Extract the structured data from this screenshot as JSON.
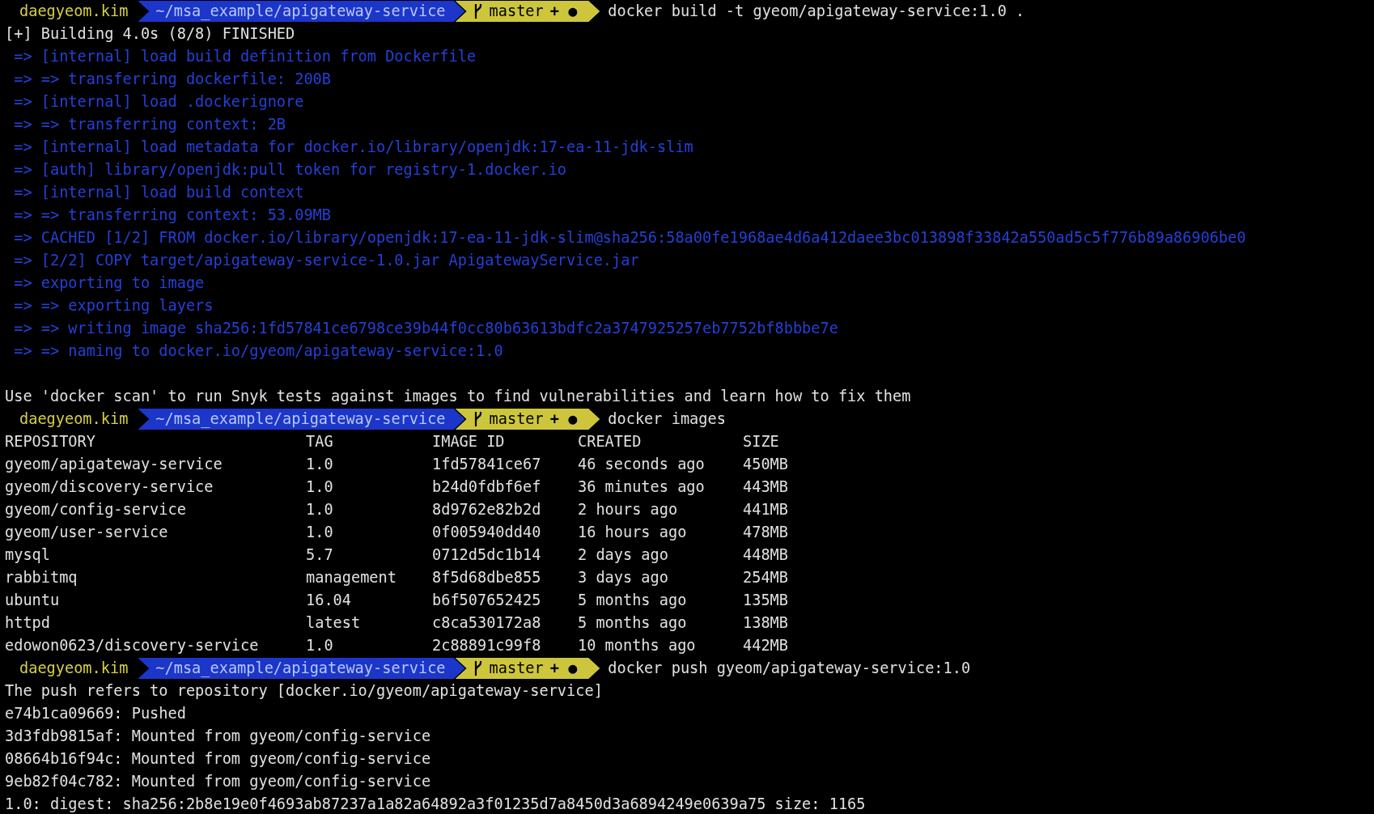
{
  "blocks": [
    {
      "kind": "prompt",
      "user": "daegyeom.kim",
      "path": "~/msa_example/apigateway-service",
      "branch": "master",
      "status": "+ ●",
      "command": "docker build -t gyeom/apigateway-service:1.0 ."
    },
    {
      "kind": "output",
      "text": "[+] Building 4.0s (8/8) FINISHED"
    },
    {
      "kind": "build",
      "text": " => [internal] load build definition from Dockerfile"
    },
    {
      "kind": "build",
      "text": " => => transferring dockerfile: 200B"
    },
    {
      "kind": "build",
      "text": " => [internal] load .dockerignore"
    },
    {
      "kind": "build",
      "text": " => => transferring context: 2B"
    },
    {
      "kind": "build",
      "text": " => [internal] load metadata for docker.io/library/openjdk:17-ea-11-jdk-slim"
    },
    {
      "kind": "build",
      "text": " => [auth] library/openjdk:pull token for registry-1.docker.io"
    },
    {
      "kind": "build",
      "text": " => [internal] load build context"
    },
    {
      "kind": "build",
      "text": " => => transferring context: 53.09MB"
    },
    {
      "kind": "build",
      "text": " => CACHED [1/2] FROM docker.io/library/openjdk:17-ea-11-jdk-slim@sha256:58a00fe1968ae4d6a412daee3bc013898f33842a550ad5c5f776b89a86906be0"
    },
    {
      "kind": "build",
      "text": " => [2/2] COPY target/apigateway-service-1.0.jar ApigatewayService.jar"
    },
    {
      "kind": "build",
      "text": " => exporting to image"
    },
    {
      "kind": "build",
      "text": " => => exporting layers"
    },
    {
      "kind": "build",
      "text": " => => writing image sha256:1fd57841ce6798ce39b44f0cc80b63613bdfc2a3747925257eb7752bf8bbbe7e"
    },
    {
      "kind": "build",
      "text": " => => naming to docker.io/gyeom/apigateway-service:1.0"
    },
    {
      "kind": "blank"
    },
    {
      "kind": "output",
      "text": "Use 'docker scan' to run Snyk tests against images to find vulnerabilities and learn how to fix them"
    },
    {
      "kind": "prompt",
      "user": "daegyeom.kim",
      "path": "~/msa_example/apigateway-service",
      "branch": "master",
      "status": "+ ●",
      "command": "docker images"
    },
    {
      "kind": "table",
      "columns": [
        "REPOSITORY",
        "TAG",
        "IMAGE ID",
        "CREATED",
        "SIZE"
      ],
      "rows": [
        [
          "gyeom/apigateway-service",
          "1.0",
          "1fd57841ce67",
          "46 seconds ago",
          "450MB"
        ],
        [
          "gyeom/discovery-service",
          "1.0",
          "b24d0fdbf6ef",
          "36 minutes ago",
          "443MB"
        ],
        [
          "gyeom/config-service",
          "1.0",
          "8d9762e82b2d",
          "2 hours ago",
          "441MB"
        ],
        [
          "gyeom/user-service",
          "1.0",
          "0f005940dd40",
          "16 hours ago",
          "478MB"
        ],
        [
          "mysql",
          "5.7",
          "0712d5dc1b14",
          "2 days ago",
          "448MB"
        ],
        [
          "rabbitmq",
          "management",
          "8f5d68dbe855",
          "3 days ago",
          "254MB"
        ],
        [
          "ubuntu",
          "16.04",
          "b6f507652425",
          "5 months ago",
          "135MB"
        ],
        [
          "httpd",
          "latest",
          "c8ca530172a8",
          "5 months ago",
          "138MB"
        ],
        [
          "edowon0623/discovery-service",
          "1.0",
          "2c88891c99f8",
          "10 months ago",
          "442MB"
        ]
      ]
    },
    {
      "kind": "prompt",
      "user": "daegyeom.kim",
      "path": "~/msa_example/apigateway-service",
      "branch": "master",
      "status": "+ ●",
      "command": "docker push gyeom/apigateway-service:1.0"
    },
    {
      "kind": "output",
      "text": "The push refers to repository [docker.io/gyeom/apigateway-service]"
    },
    {
      "kind": "output",
      "text": "e74b1ca09669: Pushed"
    },
    {
      "kind": "output",
      "text": "3d3fdb9815af: Mounted from gyeom/config-service"
    },
    {
      "kind": "output",
      "text": "08664b16f94c: Mounted from gyeom/config-service"
    },
    {
      "kind": "output",
      "text": "9eb82f04c782: Mounted from gyeom/config-service"
    },
    {
      "kind": "output",
      "text": "1.0: digest: sha256:2b8e19e0f4693ab87237a1a82a64892a3f01235d7a8450d3a6894249e0639a75 size: 1165"
    }
  ]
}
